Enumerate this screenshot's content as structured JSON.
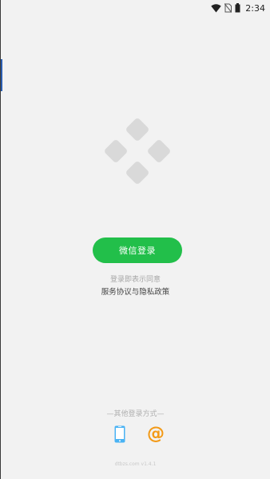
{
  "status_bar": {
    "time": "2:34",
    "icons": [
      "wifi-icon",
      "no-sim-icon",
      "battery-icon"
    ]
  },
  "logo": {
    "icon": "four-diamond-logo-icon",
    "color": "#d9d9d9"
  },
  "login": {
    "wechat_button_label": "微信登录",
    "button_color": "#22bf4a"
  },
  "agreement": {
    "note": "登录即表示同意",
    "link": "服务协议与隐私政策"
  },
  "other_login": {
    "label": "—其他登录方式—",
    "phone_icon": "phone-icon",
    "phone_color": "#4ab3f4",
    "email_icon": "at-icon",
    "email_symbol": "@",
    "email_color": "#f39a17"
  },
  "footer": {
    "text": "dtbzs.com v1.4.1"
  }
}
